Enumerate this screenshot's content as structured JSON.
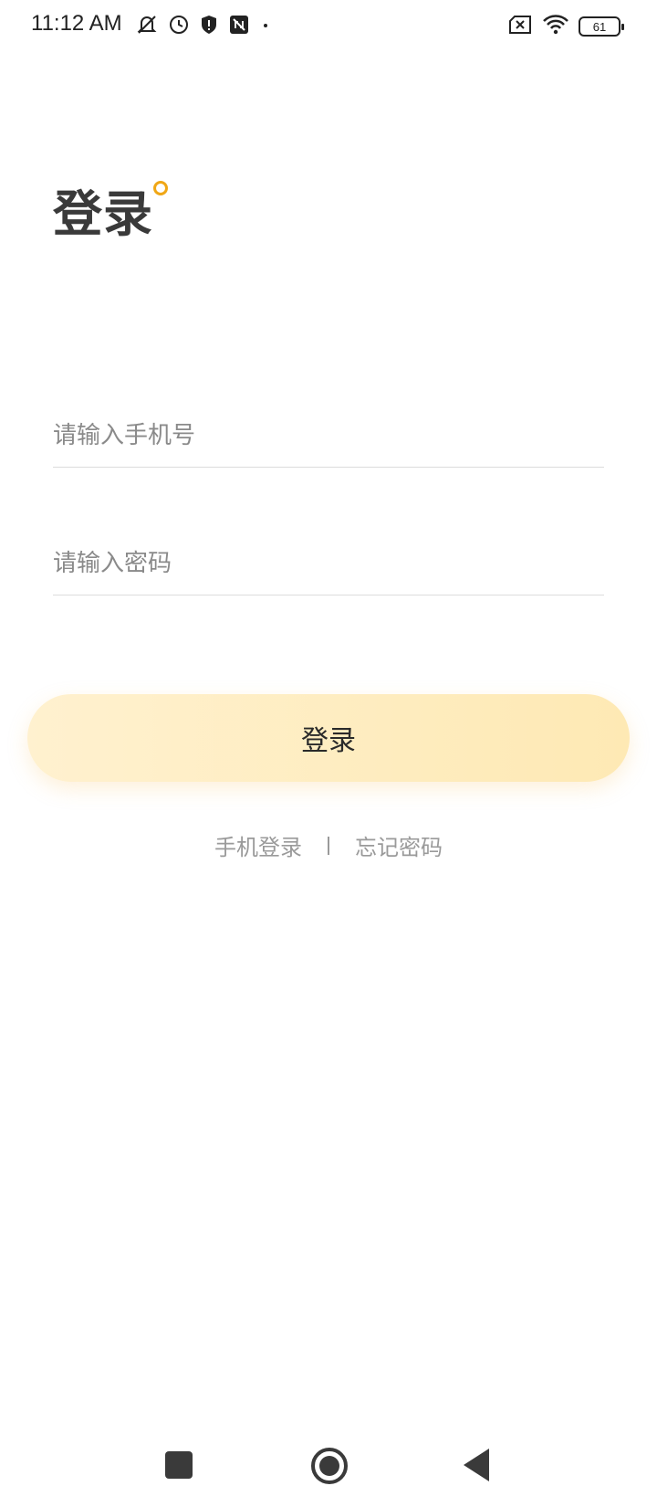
{
  "status_bar": {
    "time": "11:12 AM",
    "battery": "61",
    "icons_left": [
      "mute-icon",
      "clock-icon",
      "shield-icon",
      "no-data-icon",
      "dot-icon"
    ],
    "icons_right": [
      "no-sim-icon",
      "wifi-icon",
      "battery-icon"
    ]
  },
  "login": {
    "title": "登录",
    "phone_placeholder": "请输入手机号",
    "password_placeholder": "请输入密码",
    "submit_label": "登录",
    "phone_login_link": "手机登录",
    "forgot_password_link": "忘记密码"
  },
  "colors": {
    "accent": "#f0a716",
    "button_start": "#fff1cf",
    "button_end": "#fee9b4",
    "placeholder": "#8a8a8a",
    "link": "#9a9a9a"
  },
  "nav_bar": {
    "icons": [
      "recents-icon",
      "home-icon",
      "back-icon"
    ]
  }
}
